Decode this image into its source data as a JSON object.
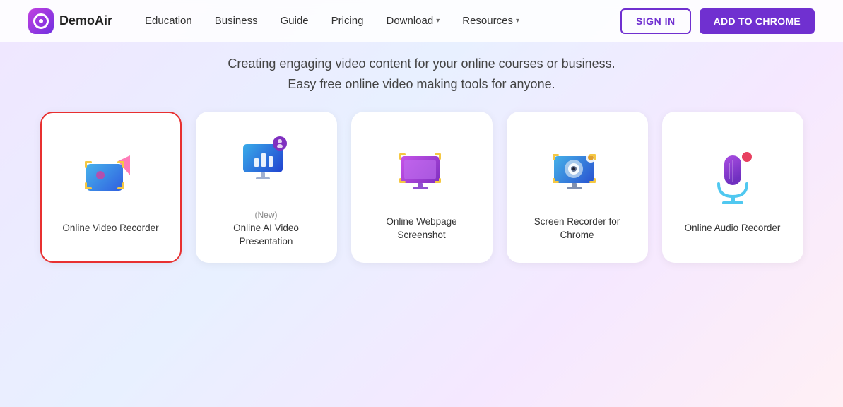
{
  "brand": {
    "name": "DemoAir"
  },
  "nav": {
    "items": [
      {
        "label": "Education",
        "hasDropdown": false
      },
      {
        "label": "Business",
        "hasDropdown": false
      },
      {
        "label": "Guide",
        "hasDropdown": false
      },
      {
        "label": "Pricing",
        "hasDropdown": false
      },
      {
        "label": "Download",
        "hasDropdown": true
      },
      {
        "label": "Resources",
        "hasDropdown": true
      }
    ],
    "signin_label": "SIGN IN",
    "add_chrome_label": "ADD TO CHROME"
  },
  "hero": {
    "line1": "Creating engaging video content for your online courses or business.",
    "line2": "Easy free online video making tools for anyone."
  },
  "cards": [
    {
      "id": "online-video-recorder",
      "label": "Online Video Recorder",
      "new_badge": "",
      "selected": true
    },
    {
      "id": "online-ai-video-presentation",
      "label": "Online AI Video Presentation",
      "new_badge": "(New)",
      "selected": false
    },
    {
      "id": "online-webpage-screenshot",
      "label": "Online Webpage Screenshot",
      "new_badge": "",
      "selected": false
    },
    {
      "id": "screen-recorder-chrome",
      "label": "Screen Recorder for Chrome",
      "new_badge": "",
      "selected": false
    },
    {
      "id": "online-audio-recorder",
      "label": "Online Audio Recorder",
      "new_badge": "",
      "selected": false
    }
  ]
}
